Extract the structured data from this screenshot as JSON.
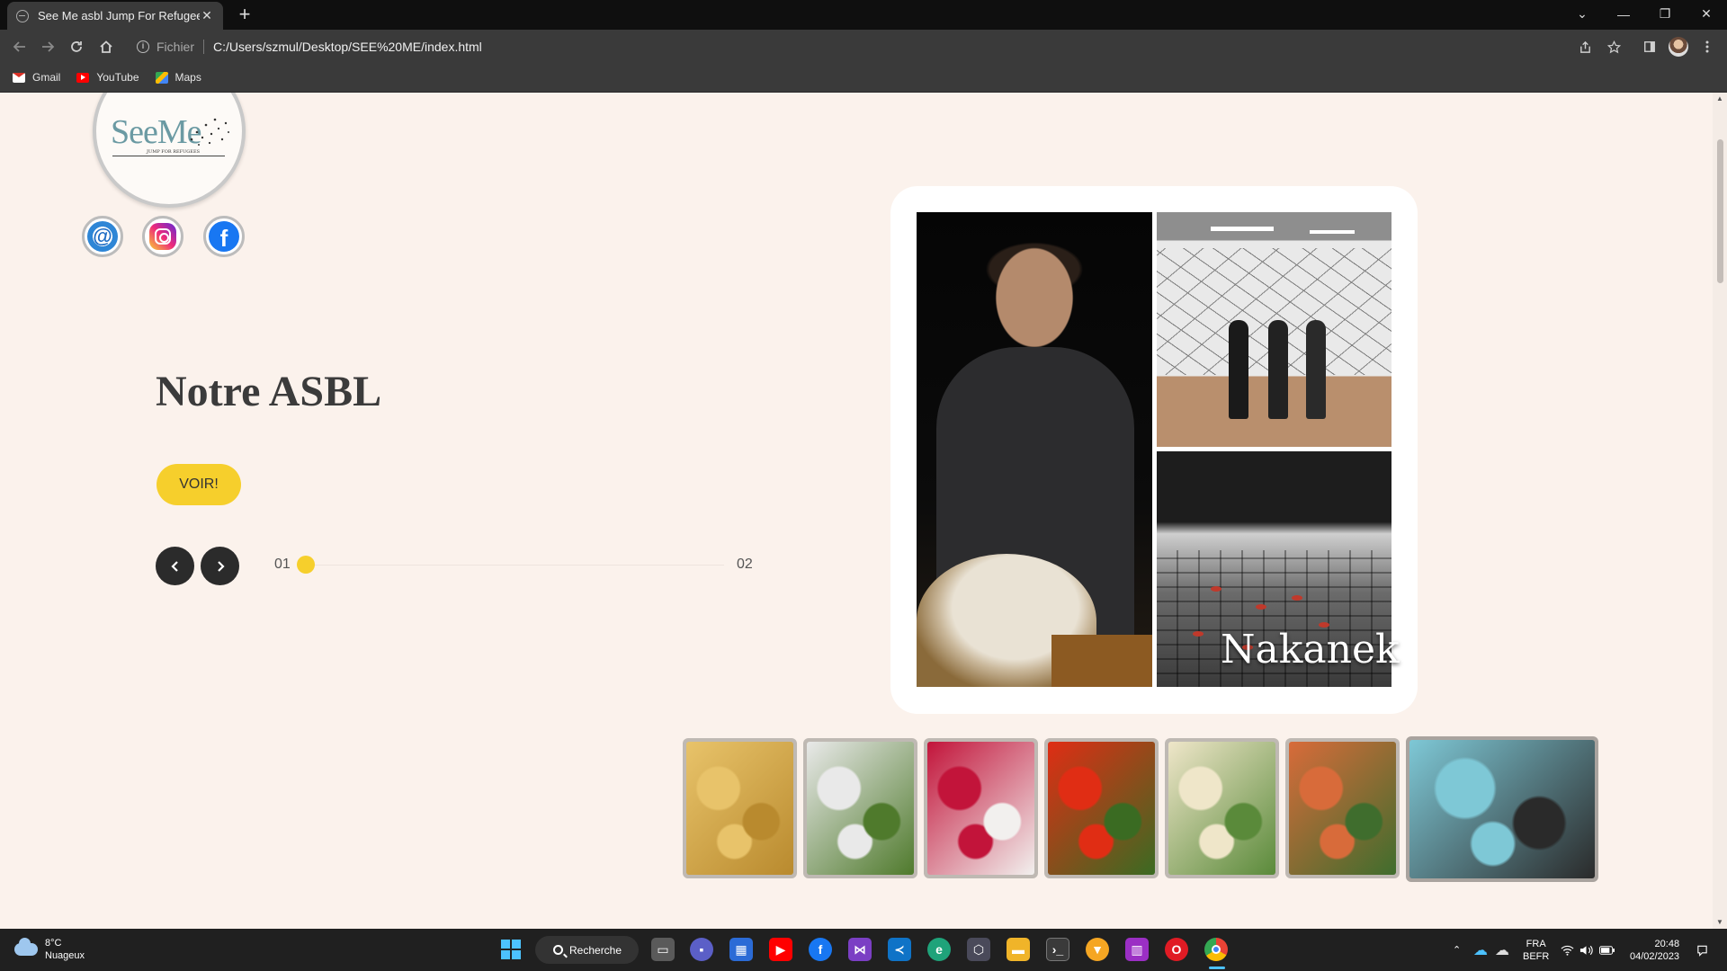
{
  "browser": {
    "tab_title": "See Me asbl Jump For Refugees",
    "tab_close": "✕",
    "new_tab": "+",
    "url_scheme": "Fichier",
    "url": "C:/Users/szmul/Desktop/SEE%20ME/index.html",
    "bookmarks": [
      "Gmail",
      "YouTube",
      "Maps"
    ],
    "window_controls": [
      "⌄",
      "—",
      "❐",
      "✕"
    ]
  },
  "logo": {
    "text": "SeeMe",
    "subtitle": "JUMP FOR REFUGEES"
  },
  "social": {
    "mail_glyph": "@",
    "facebook_glyph": "f"
  },
  "hero": {
    "title": "Notre ASBL",
    "cta_label": "VOIR!",
    "prev_glyph": "‹",
    "next_glyph": "›",
    "slide_current": "01",
    "slide_total": "02",
    "slide_progress_fraction": 0.0
  },
  "collage": {
    "caption": "Nakanek"
  },
  "thumbnails": [
    {
      "name": "samosas",
      "colors": [
        "#e8c36a",
        "#b98a2e"
      ]
    },
    {
      "name": "salad",
      "colors": [
        "#e9e9e9",
        "#4f7a2c"
      ]
    },
    {
      "name": "pomegranate",
      "colors": [
        "#c2143a",
        "#f2f0ee"
      ]
    },
    {
      "name": "tomatoes",
      "colors": [
        "#e02d14",
        "#3a6b22"
      ]
    },
    {
      "name": "soup",
      "colors": [
        "#efe6c9",
        "#5a8a3a"
      ]
    },
    {
      "name": "salad-bowls",
      "colors": [
        "#d86b3a",
        "#3f6d2d"
      ]
    },
    {
      "name": "buffet",
      "colors": [
        "#7ec8d6",
        "#2a2a2a"
      ]
    }
  ],
  "taskbar": {
    "temperature": "8°C",
    "weather": "Nuageux",
    "search_label": "Recherche",
    "language_1": "FRA",
    "language_2": "BEFR",
    "time": "20:48",
    "date": "04/02/2023"
  },
  "colors": {
    "page_bg": "#fbf2ec",
    "accent_yellow": "#f6cf2c",
    "dark_button": "#2b2b2b"
  }
}
